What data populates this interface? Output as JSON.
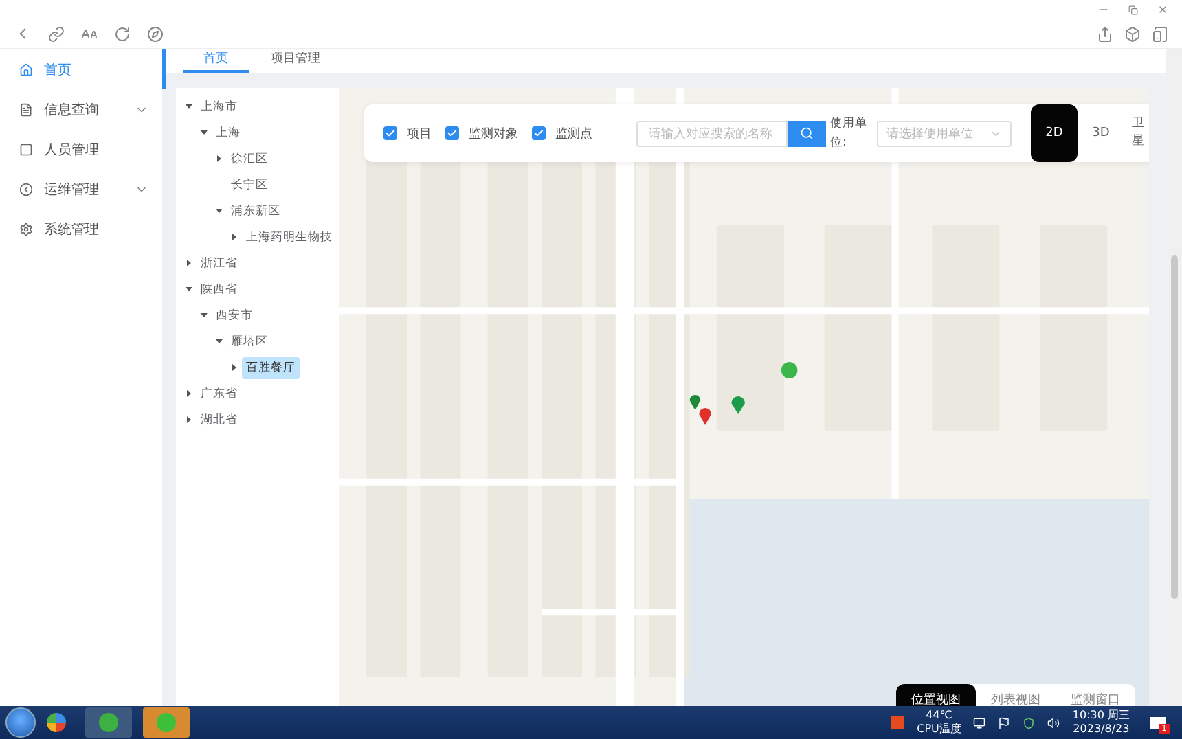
{
  "sidebar": {
    "items": [
      {
        "label": "首页",
        "selected": true,
        "expandable": false
      },
      {
        "label": "信息查询",
        "selected": false,
        "expandable": true
      },
      {
        "label": "人员管理",
        "selected": false,
        "expandable": false
      },
      {
        "label": "运维管理",
        "selected": false,
        "expandable": true
      },
      {
        "label": "系统管理",
        "selected": false,
        "expandable": false
      }
    ]
  },
  "tabs": [
    {
      "label": "首页",
      "selected": true
    },
    {
      "label": "项目管理",
      "selected": false
    }
  ],
  "tree": [
    {
      "label": "上海市",
      "expanded": true,
      "selected": false,
      "children": [
        {
          "label": "上海",
          "expanded": true,
          "selected": false,
          "children": [
            {
              "label": "徐汇区",
              "expanded": false,
              "selected": false
            },
            {
              "label": "长宁区",
              "selected": false
            },
            {
              "label": "浦东新区",
              "expanded": true,
              "selected": false,
              "children": [
                {
                  "label": "上海药明生物技",
                  "expanded": false,
                  "selected": false
                }
              ]
            }
          ]
        }
      ]
    },
    {
      "label": "浙江省",
      "expanded": false,
      "selected": false
    },
    {
      "label": "陕西省",
      "expanded": true,
      "selected": false,
      "children": [
        {
          "label": "西安市",
          "expanded": true,
          "selected": false,
          "children": [
            {
              "label": "雁塔区",
              "expanded": true,
              "selected": false,
              "children": [
                {
                  "label": "百胜餐厅",
                  "expanded": false,
                  "selected": true
                }
              ]
            }
          ]
        }
      ]
    },
    {
      "label": "广东省",
      "expanded": false,
      "selected": false
    },
    {
      "label": "湖北省",
      "expanded": false,
      "selected": false
    }
  ],
  "map_filters": [
    {
      "label": "项目",
      "checked": true
    },
    {
      "label": "监测对象",
      "checked": true
    },
    {
      "label": "监测点",
      "checked": true
    }
  ],
  "search": {
    "placeholder": "请输入对应搜索的名称"
  },
  "unit": {
    "label": "使用单位:",
    "placeholder": "请选择使用单位"
  },
  "map_modes": [
    {
      "label": "2D",
      "selected": true
    },
    {
      "label": "3D",
      "selected": false
    },
    {
      "label": "卫星",
      "selected": false
    }
  ],
  "view_tabs": [
    {
      "label": "位置视图",
      "selected": true
    },
    {
      "label": "列表视图",
      "selected": false
    },
    {
      "label": "监测窗口",
      "selected": false
    }
  ],
  "taskbar": {
    "temperature": "44℃",
    "temperature_label": "CPU温度",
    "time": "10:30 周三",
    "date": "2023/8/23",
    "notification_count": "1"
  }
}
